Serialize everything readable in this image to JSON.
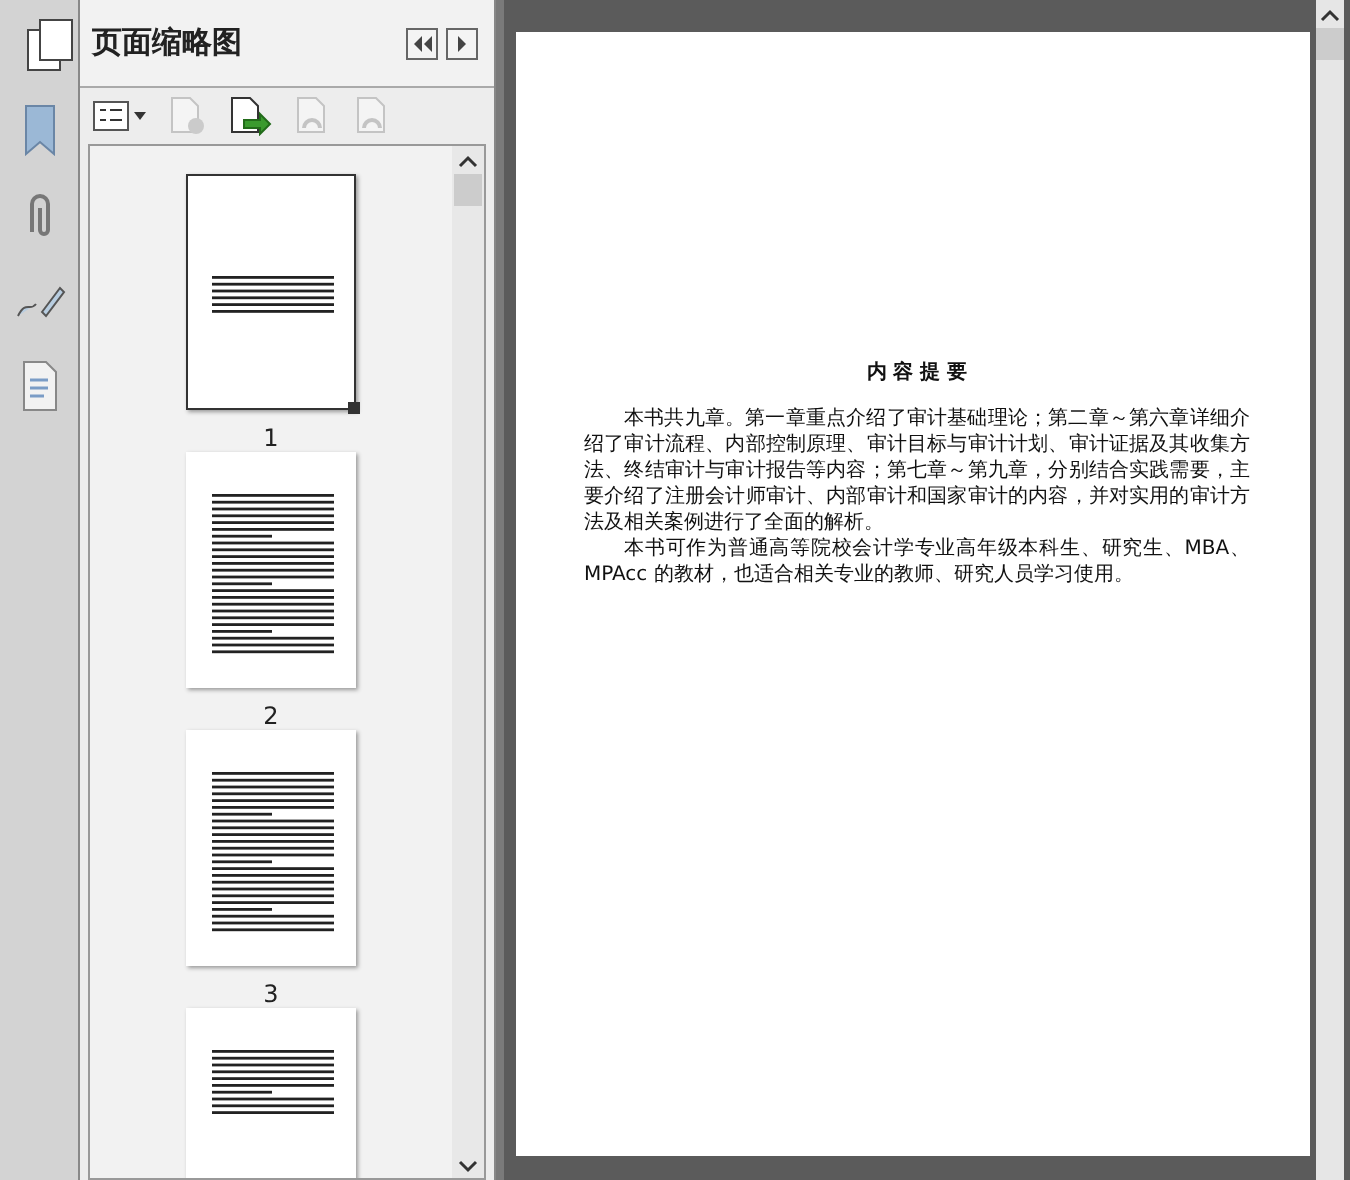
{
  "panel": {
    "title": "页面缩略图"
  },
  "thumbnails": [
    {
      "label": "1",
      "selected": true
    },
    {
      "label": "2",
      "selected": false
    },
    {
      "label": "3",
      "selected": false
    },
    {
      "selected": false
    }
  ],
  "document": {
    "heading": "内 容 提 要",
    "paragraphs": [
      "本书共九章。第一章重点介绍了审计基础理论；第二章～第六章详细介绍了审计流程、内部控制原理、审计目标与审计计划、审计证据及其收集方法、终结审计与审计报告等内容；第七章～第九章，分别结合实践需要，主要介绍了注册会计师审计、内部审计和国家审计的内容，并对实用的审计方法及相关案例进行了全面的解析。",
      "本书可作为普通高等院校会计学专业高年级本科生、研究生、MBA、MPAcc 的教材，也适合相关专业的教师、研究人员学习使用。"
    ]
  }
}
